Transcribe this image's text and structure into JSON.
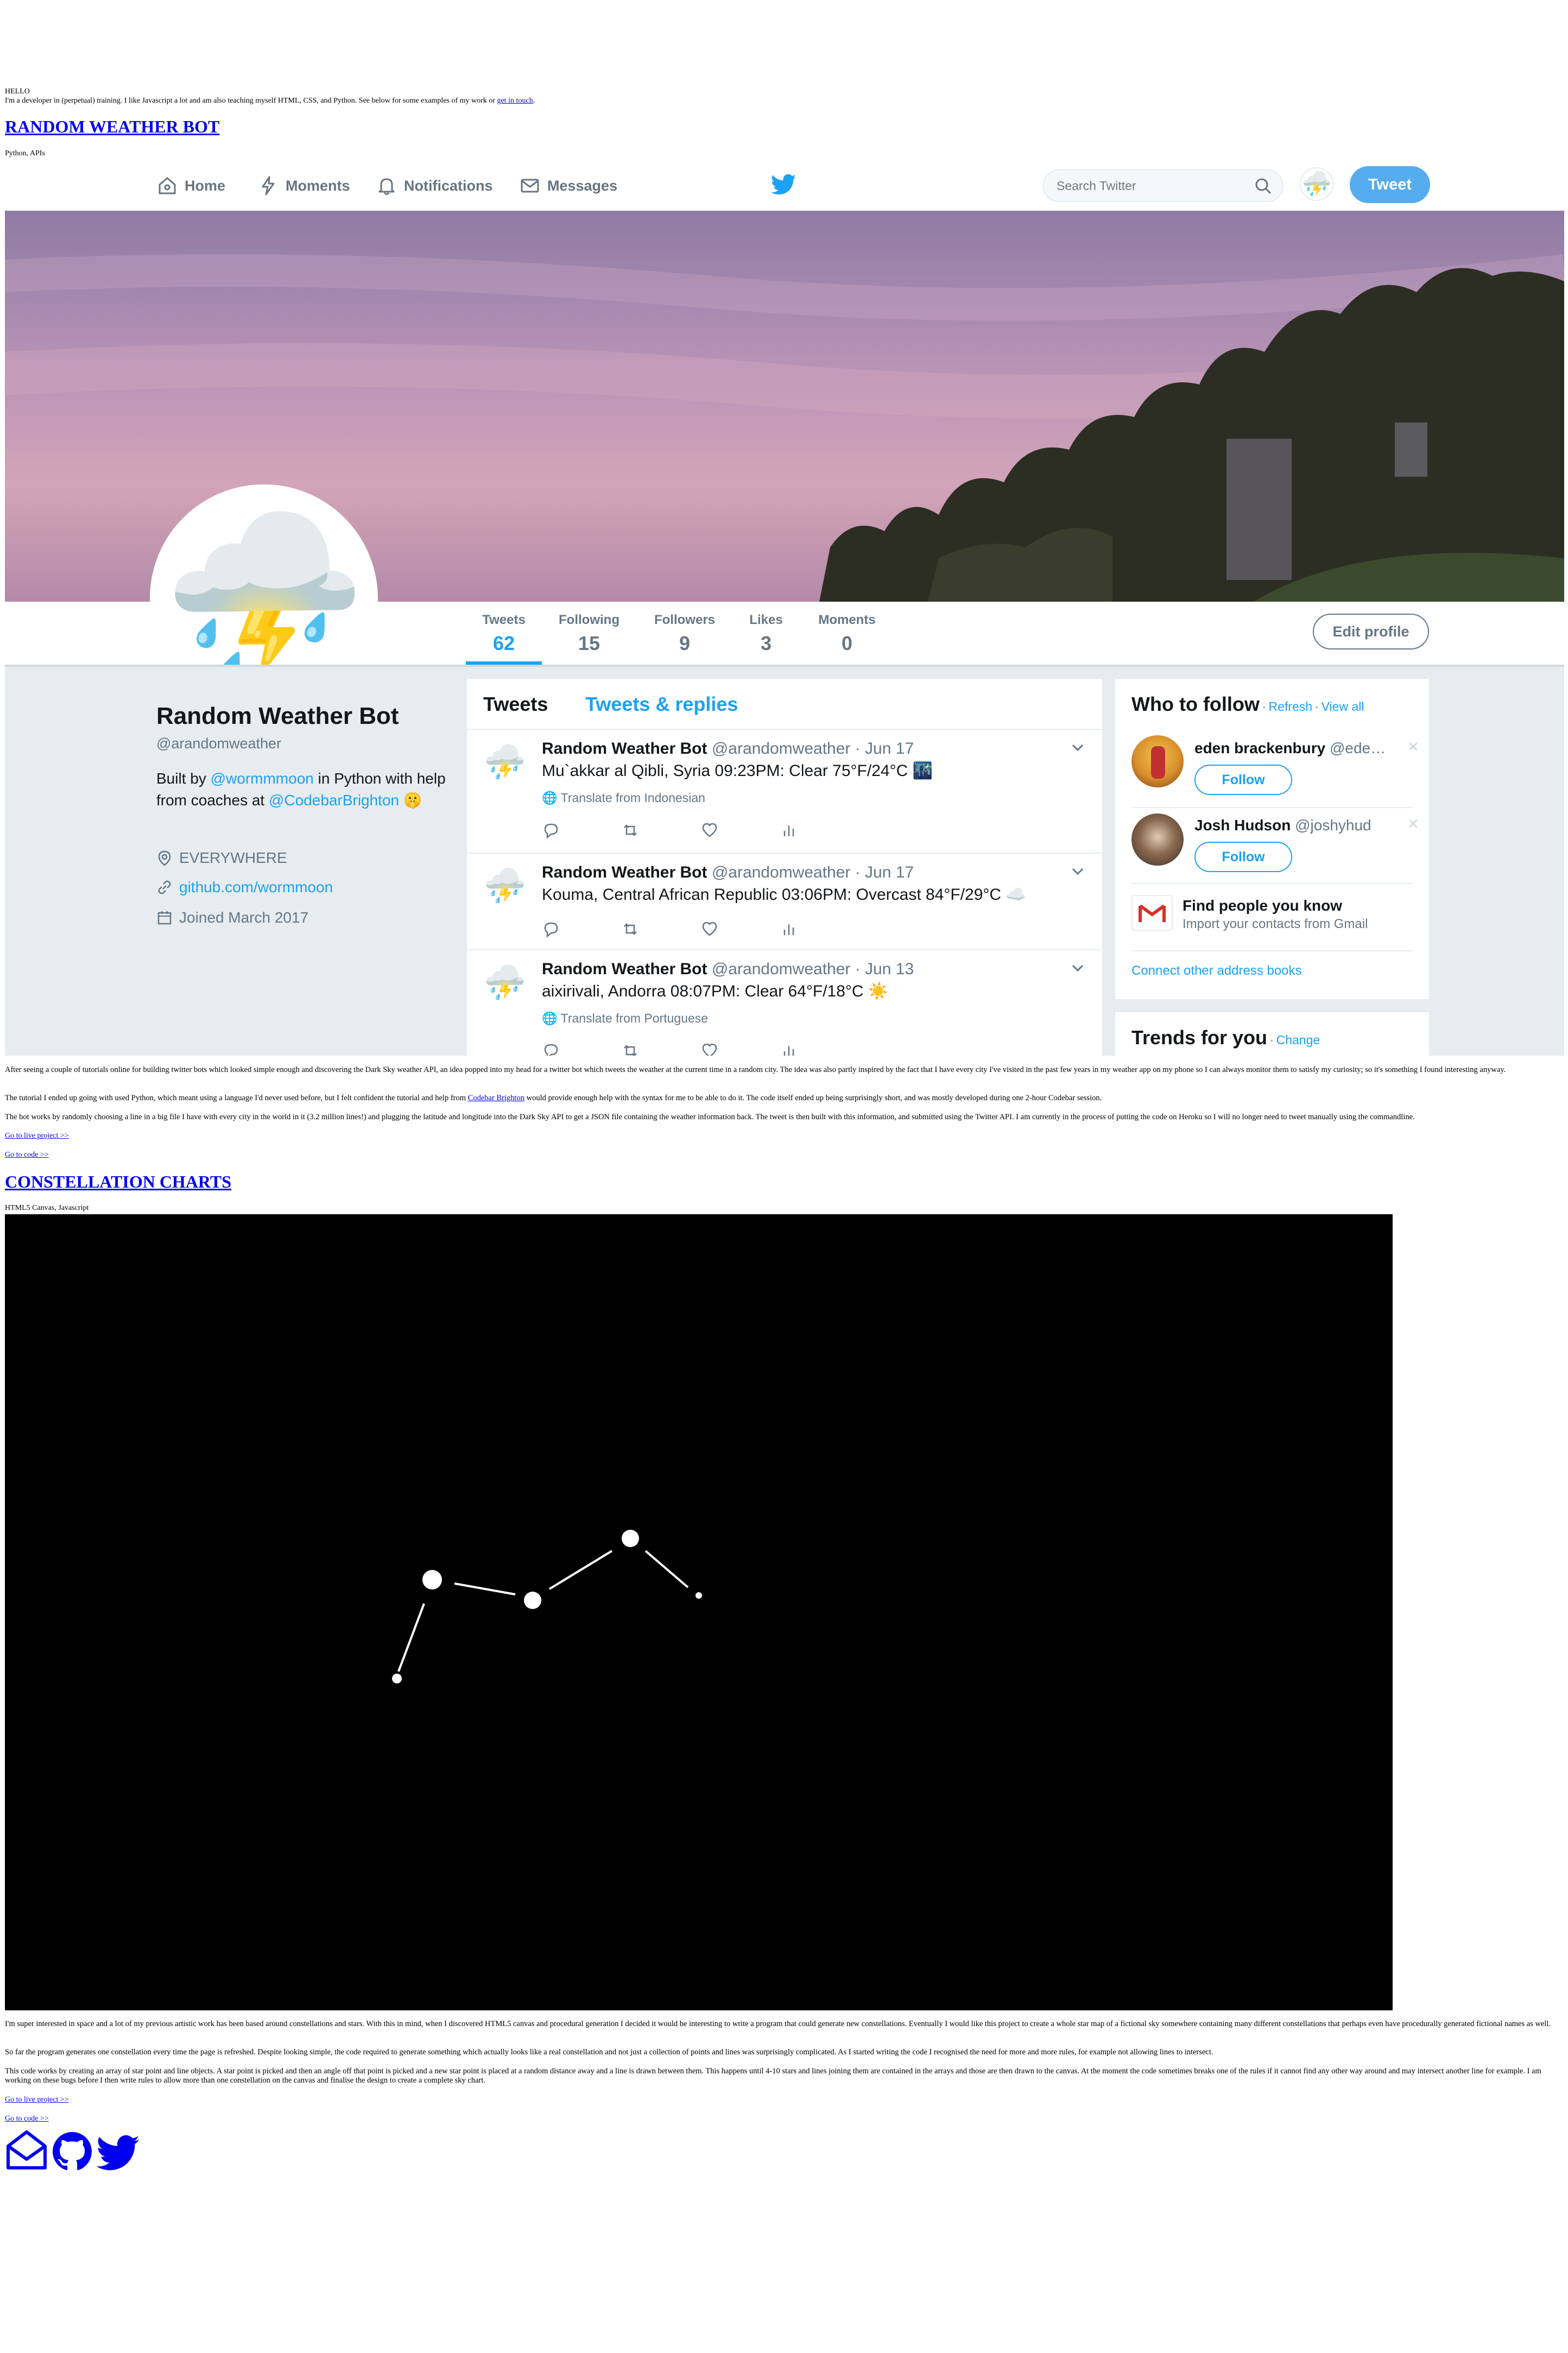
{
  "intro": {
    "hello": "HELLO",
    "line_before_link": "I'm a developer in (perpetual) training. I like Javascript a lot and am also teaching myself HTML, CSS, and Python. See below for some examples of my work or",
    "link": "get in touch",
    "line_after_link": "."
  },
  "project1": {
    "title": "RANDOM WEATHER BOT",
    "tech": "Python, APIs",
    "paragraphs": [
      "After seeing a couple of tutorials online for building twitter bots which looked simple enough and discovering the Dark Sky weather API, an idea popped into my head for a twitter bot which tweets the weather at the current time in a random city. The idea was also partly inspired by the fact that I have every city I've visited in the past few years in my weather app on my phone so I can always monitor them to satisfy my curiosity; so it's something I found interesting anyway.",
      "The bot works by randomly choosing a line in a big file I have with every city in the world in it (3.2 million lines!) and plugging the latitude and longitude into the Dark Sky API to get a JSON file containing the weather information back. The tweet is then built with this information, and submitted using the Twitter API. I am currently in the process of putting the code on Heroku so I will no longer need to tweet manually using the commandline."
    ],
    "p2_before": "The tutorial I ended up going with used Python, which meant using a language I'd never used before, but I felt confident the tutorial and help from",
    "p2_link": "Codebar Brighton",
    "p2_after": "would provide enough help with the syntax for me to be able to do it. The code itself ended up being surprisingly short, and was mostly developed during one 2-hour Codebar session.",
    "live_link": "Go to live project >>",
    "code_link": "Go to code >>"
  },
  "twitter": {
    "nav": {
      "home": "Home",
      "moments": "Moments",
      "notifications": "Notifications",
      "messages": "Messages",
      "search_placeholder": "Search Twitter",
      "tweet_button": "Tweet"
    },
    "stats": [
      {
        "label": "Tweets",
        "value": "62"
      },
      {
        "label": "Following",
        "value": "15"
      },
      {
        "label": "Followers",
        "value": "9"
      },
      {
        "label": "Likes",
        "value": "3"
      },
      {
        "label": "Moments",
        "value": "0"
      }
    ],
    "edit_profile": "Edit profile",
    "profile": {
      "name": "Random Weather Bot",
      "handle": "@arandomweather",
      "bio_1": "Built by",
      "bio_link1": "@wormmmoon",
      "bio_2": "in Python with help from coaches at",
      "bio_link2": "@CodebarBrighton",
      "location": "EVERYWHERE",
      "website": "github.com/wormmoon",
      "joined": "Joined March 2017"
    },
    "tabs": {
      "tweets": "Tweets",
      "replies": "Tweets & replies"
    },
    "tweets": [
      {
        "name": "Random Weather Bot",
        "handle": "@arandomweather · Jun 17",
        "text": "Mu`akkar al Qibli, Syria 09:23PM: Clear 75°F/24°C 🌃",
        "translate": "Translate from Indonesian"
      },
      {
        "name": "Random Weather Bot",
        "handle": "@arandomweather · Jun 17",
        "text": "Kouma, Central African Republic 03:06PM: Overcast 84°F/29°C ☁️",
        "translate": ""
      },
      {
        "name": "Random Weather Bot",
        "handle": "@arandomweather · Jun 13",
        "text": "aixirivali, Andorra 08:07PM: Clear 64°F/18°C ☀️",
        "translate": "Translate from Portuguese"
      }
    ],
    "who_to_follow": {
      "title": "Who to follow",
      "refresh": "Refresh",
      "view_all": "View all",
      "separator": "·",
      "users": [
        {
          "name": "eden brackenbury",
          "handle": "@ede…",
          "follow": "Follow"
        },
        {
          "name": "Josh Hudson",
          "handle": "@joshyhud",
          "follow": "Follow"
        }
      ],
      "find_people": "Find people you know",
      "import": "Import your contacts from Gmail",
      "connect": "Connect other address books"
    },
    "trends": {
      "title": "Trends for you",
      "change": "Change"
    }
  },
  "project2": {
    "title": "CONSTELLATION CHARTS",
    "tech": "HTML5 Canvas, Javascript",
    "paragraphs": [
      "I'm super interested in space and a lot of my previous artistic work has been based around constellations and stars. With this in mind, when I discovered HTML5 canvas and procedural generation I decided it would be interesting to write a program that could generate new constellations. Eventually I would like this project to create a whole star map of a fictional sky somewhere containing many different constellations that perhaps even have procedurally generated fictional names as well.",
      "So far the program generates one constellation every time the page is refreshed. Despite looking simple, the code required to generate something which actually looks like a real constellation and not just a collection of points and lines was surprisingly complicated. As I started writing the code I recognised the need for more and more rules, for example not allowing lines to intersect.",
      "This code works by creating an array of star point and line objects. A star point is picked and then an angle off that point is picked and a new star point is placed at a random distance away and a line is drawn between them. This happens until 4-10 stars and lines joining them are contained in the arrays and those are then drawn to the canvas. At the moment the code sometimes breaks one of the rules if it cannot find any other way around and may intersect another line for example. I am working on these bugs before I then write rules to allow more than one constellation on the canvas and finalise the design to create a complete sky chart."
    ],
    "live_link": "Go to live project >>",
    "code_link": "Go to code >>"
  },
  "footer_icons": [
    "envelope-icon",
    "github-icon",
    "twitter-icon"
  ],
  "colors": {
    "twitter_blue": "#1da1f2",
    "link": "#0000ee",
    "muted": "#657786",
    "bg_light": "#e6ecf0"
  }
}
